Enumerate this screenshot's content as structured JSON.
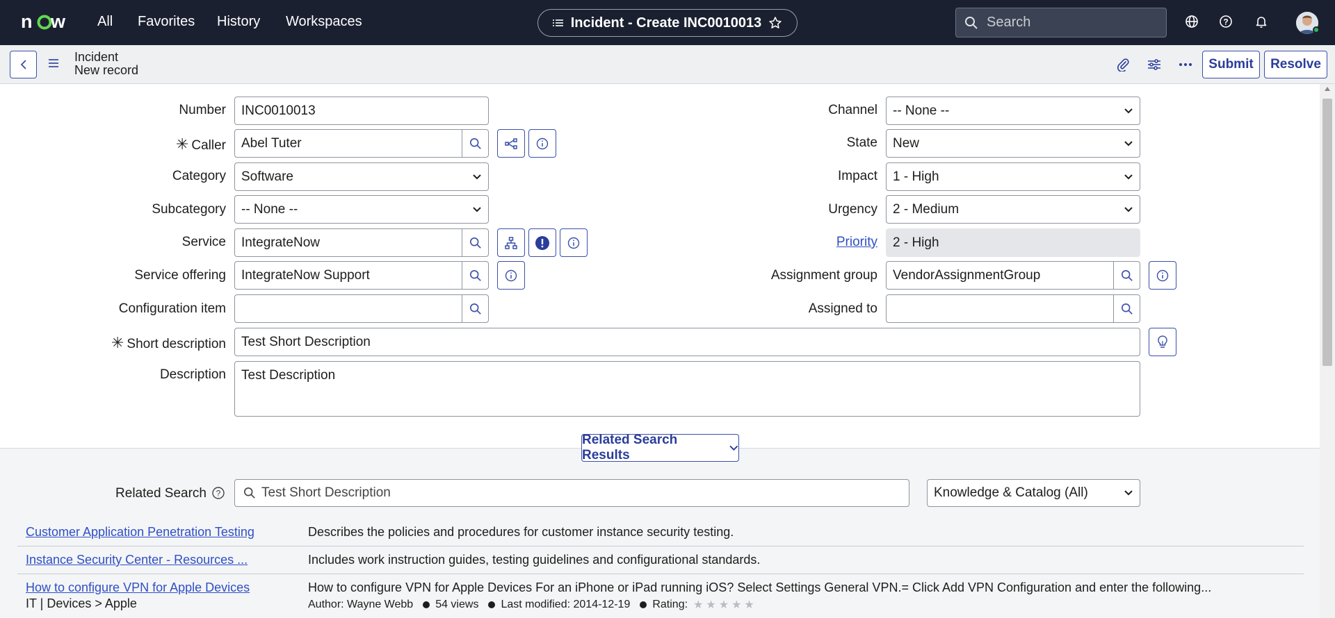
{
  "topnav": {
    "logo": "now",
    "menu": [
      "All",
      "Favorites",
      "History",
      "Workspaces"
    ],
    "context_title": "Incident - Create INC0010013",
    "search_placeholder": "Search",
    "icons": [
      "globe-icon",
      "help-icon",
      "bell-icon",
      "avatar"
    ]
  },
  "header": {
    "record_type": "Incident",
    "record_state": "New record",
    "buttons": {
      "submit": "Submit",
      "resolve": "Resolve"
    }
  },
  "form": {
    "number": {
      "label": "Number",
      "value": "INC0010013"
    },
    "caller": {
      "label": "Caller",
      "value": "Abel Tuter",
      "required": true
    },
    "category": {
      "label": "Category",
      "value": "Software"
    },
    "subcategory": {
      "label": "Subcategory",
      "value": "-- None --"
    },
    "service": {
      "label": "Service",
      "value": "IntegrateNow"
    },
    "service_offering": {
      "label": "Service offering",
      "value": "IntegrateNow Support"
    },
    "configuration_item": {
      "label": "Configuration item",
      "value": ""
    },
    "channel": {
      "label": "Channel",
      "value": "-- None --"
    },
    "state": {
      "label": "State",
      "value": "New"
    },
    "impact": {
      "label": "Impact",
      "value": "1 - High"
    },
    "urgency": {
      "label": "Urgency",
      "value": "2 - Medium"
    },
    "priority": {
      "label": "Priority",
      "value": "2 - High"
    },
    "assignment_group": {
      "label": "Assignment group",
      "value": "VendorAssignmentGroup"
    },
    "assigned_to": {
      "label": "Assigned to",
      "value": ""
    },
    "short_description": {
      "label": "Short description",
      "value": "Test Short Description",
      "required": true
    },
    "description": {
      "label": "Description",
      "value": "Test Description"
    }
  },
  "related": {
    "toggle_label": "Related Search Results",
    "search_label": "Related Search",
    "search_value": "Test Short Description",
    "source_select": "Knowledge & Catalog (All)",
    "results": [
      {
        "title": "Customer Application Penetration Testing",
        "description": "Describes the policies and procedures for customer instance security testing."
      },
      {
        "title": "Instance Security Center - Resources ...",
        "description": "Includes work instruction guides, testing guidelines and configurational standards."
      },
      {
        "title": "How to configure VPN for Apple Devices",
        "description": "How to configure VPN for Apple Devices For an iPhone or iPad running iOS? Select Settings General VPN.= Click Add VPN Configuration and enter the following...",
        "category": "IT | Devices > Apple",
        "author": "Author: Wayne Webb",
        "views": "54 views",
        "modified": "Last modified: 2014-12-19",
        "rating_label": "Rating:",
        "rating": 0
      }
    ]
  },
  "colors": {
    "nav_bg": "#1b2031",
    "accent": "#3b4fa8",
    "link": "#2f4fc6"
  }
}
